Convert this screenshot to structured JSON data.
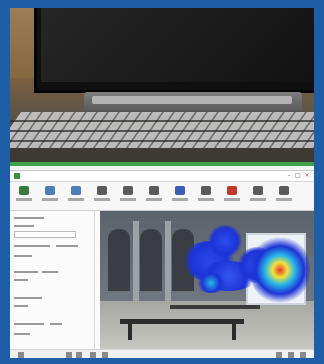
{
  "window": {
    "title": "",
    "controls": {
      "minimize": "–",
      "maximize": "□",
      "close": "×"
    }
  },
  "ribbon": {
    "buttons": [
      {
        "icon": "record-icon",
        "color": "#3a7d3a"
      },
      {
        "icon": "record-icon",
        "color": "#4b7db6"
      },
      {
        "icon": "record-icon",
        "color": "#4b7db6"
      },
      {
        "icon": "video-icon",
        "color": "#5a5a5a"
      },
      {
        "icon": "image-icon",
        "color": "#5a5a5a"
      },
      {
        "icon": "chart-icon",
        "color": "#5a5a5a"
      },
      {
        "icon": "heatmap-icon",
        "color": "#3a5fb5"
      },
      {
        "icon": "gaze-icon",
        "color": "#5a5a5a"
      },
      {
        "icon": "marker-icon",
        "color": "#c0392b"
      },
      {
        "icon": "export-icon",
        "color": "#5a5a5a"
      },
      {
        "icon": "settings-icon",
        "color": "#5a5a5a"
      }
    ]
  },
  "colors": {
    "frame": "#1d5ea6",
    "heat_blue": "#1c33d6",
    "heat_cyan": "#29b8e8",
    "heat_yellow": "#f2e23a",
    "heat_red": "#e0392b",
    "accent_green": "#3ea24a"
  }
}
